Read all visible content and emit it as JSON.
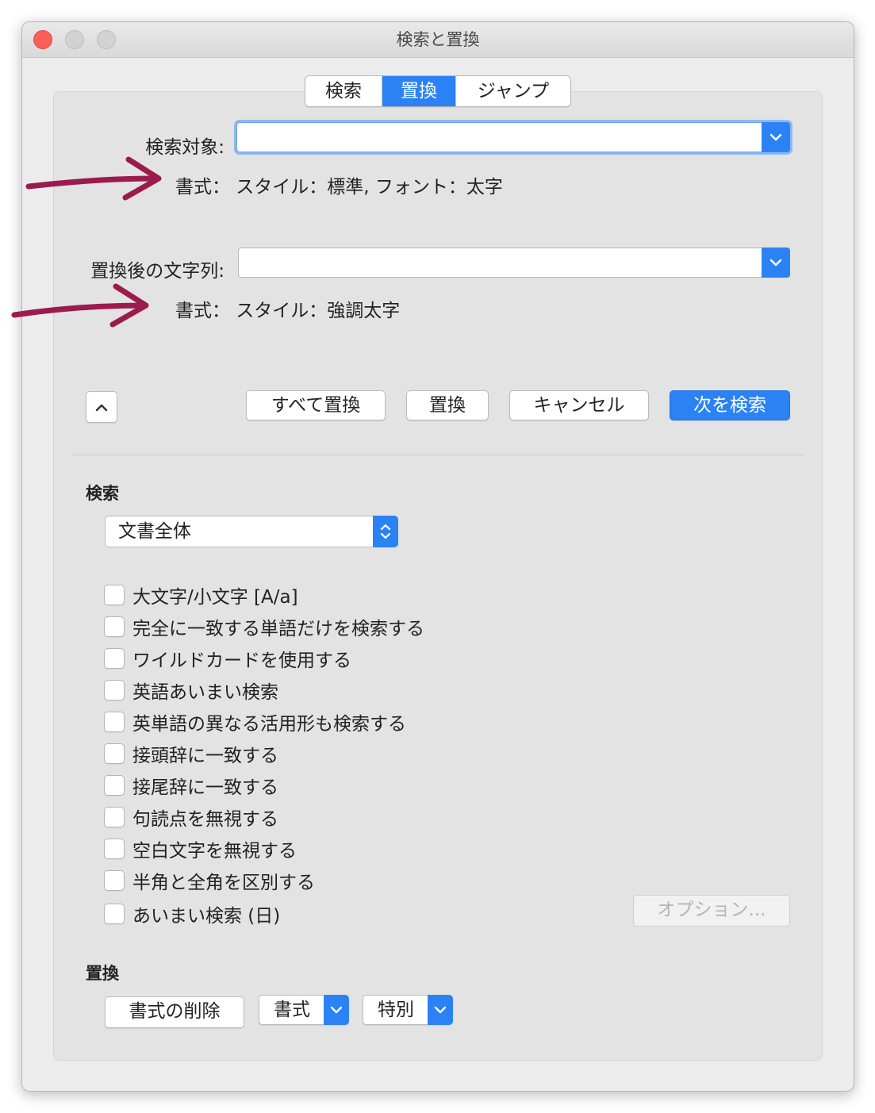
{
  "window": {
    "title": "検索と置換"
  },
  "tabs": [
    {
      "label": "検索",
      "active": false
    },
    {
      "label": "置換",
      "active": true
    },
    {
      "label": "ジャンプ",
      "active": false
    }
  ],
  "find": {
    "label": "検索対象:",
    "value": "",
    "format": "書式：  スタイル：標準, フォント：太字"
  },
  "replace": {
    "label": "置換後の文字列:",
    "value": "",
    "format": "書式：  スタイル：強調太字"
  },
  "buttons": {
    "replace_all": "すべて置換",
    "replace": "置換",
    "cancel": "キャンセル",
    "find_next": "次を検索"
  },
  "search_section": {
    "heading": "検索",
    "scope": "文書全体",
    "options": [
      {
        "label": "大文字/小文字 [A/a]",
        "checked": false
      },
      {
        "label": "完全に一致する単語だけを検索する",
        "checked": false
      },
      {
        "label": "ワイルドカードを使用する",
        "checked": false
      },
      {
        "label": "英語あいまい検索",
        "checked": false
      },
      {
        "label": "英単語の異なる活用形も検索する",
        "checked": false
      },
      {
        "label": "接頭辞に一致する",
        "checked": false
      },
      {
        "label": "接尾辞に一致する",
        "checked": false
      },
      {
        "label": "句読点を無視する",
        "checked": false
      },
      {
        "label": "空白文字を無視する",
        "checked": false
      },
      {
        "label": "半角と全角を区別する",
        "checked": false
      },
      {
        "label": "あいまい検索 (日)",
        "checked": false
      }
    ],
    "options_button": "オプション..."
  },
  "replace_section": {
    "heading": "置換",
    "clear_format": "書式の削除",
    "format": "書式",
    "special": "特別"
  },
  "colors": {
    "accent": "#2b82f4",
    "annotation_arrow": "#9b1b4e",
    "close_button": "#fc5f57"
  }
}
